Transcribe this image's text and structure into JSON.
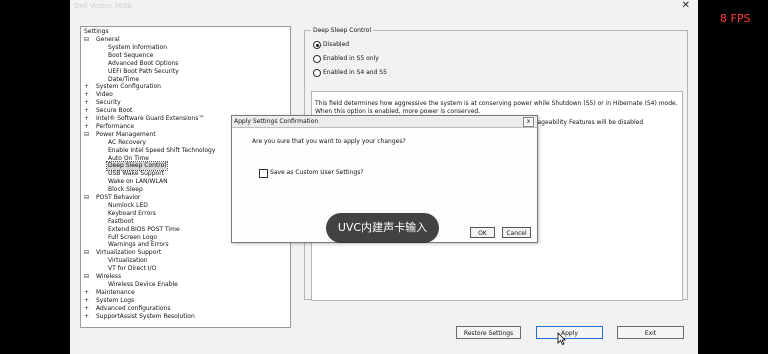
{
  "window": {
    "title": "Dell Vostro 3690",
    "close_glyph": "✕"
  },
  "overlay": {
    "fps": "8 FPS",
    "toast": "UVC内建声卡输入"
  },
  "settings": {
    "title": "Settings",
    "tree": [
      {
        "level": 0,
        "expander": "⊟",
        "label": "General"
      },
      {
        "level": 1,
        "label": "System Information"
      },
      {
        "level": 1,
        "label": "Boot Sequence"
      },
      {
        "level": 1,
        "label": "Advanced Boot Options"
      },
      {
        "level": 1,
        "label": "UEFI Boot Path Security"
      },
      {
        "level": 1,
        "label": "Date/Time"
      },
      {
        "level": 0,
        "expander": "+",
        "label": "System Configuration"
      },
      {
        "level": 0,
        "expander": "+",
        "label": "Video"
      },
      {
        "level": 0,
        "expander": "+",
        "label": "Security"
      },
      {
        "level": 0,
        "expander": "+",
        "label": "Secure Boot"
      },
      {
        "level": 0,
        "expander": "+",
        "label": "Intel® Software Guard Extensions™"
      },
      {
        "level": 0,
        "expander": "+",
        "label": "Performance"
      },
      {
        "level": 0,
        "expander": "⊟",
        "label": "Power Management"
      },
      {
        "level": 1,
        "label": "AC Recovery"
      },
      {
        "level": 1,
        "label": "Enable Intel Speed Shift Technology"
      },
      {
        "level": 1,
        "label": "Auto On Time"
      },
      {
        "level": 1,
        "label": "Deep Sleep Control",
        "selected": true
      },
      {
        "level": 1,
        "label": "USB Wake Support"
      },
      {
        "level": 1,
        "label": "Wake on LAN/WLAN"
      },
      {
        "level": 1,
        "label": "Block Sleep"
      },
      {
        "level": 0,
        "expander": "⊟",
        "label": "POST Behavior"
      },
      {
        "level": 1,
        "label": "Numlock LED"
      },
      {
        "level": 1,
        "label": "Keyboard Errors"
      },
      {
        "level": 1,
        "label": "Fastboot"
      },
      {
        "level": 1,
        "label": "Extend BIOS POST Time"
      },
      {
        "level": 1,
        "label": "Full Screen Logo"
      },
      {
        "level": 1,
        "label": "Warnings and Errors"
      },
      {
        "level": 0,
        "expander": "⊟",
        "label": "Virtualization Support"
      },
      {
        "level": 1,
        "label": "Virtualization"
      },
      {
        "level": 1,
        "label": "VT for Direct I/O"
      },
      {
        "level": 0,
        "expander": "⊟",
        "label": "Wireless"
      },
      {
        "level": 1,
        "label": "Wireless Device Enable"
      },
      {
        "level": 0,
        "expander": "+",
        "label": "Maintenance"
      },
      {
        "level": 0,
        "expander": "+",
        "label": "System Logs"
      },
      {
        "level": 0,
        "expander": "+",
        "label": "Advanced configurations"
      },
      {
        "level": 0,
        "expander": "+",
        "label": "SupportAssist System Resolution"
      }
    ]
  },
  "deep_sleep": {
    "group_title": "Deep Sleep Control",
    "options": [
      {
        "label": "Disabled",
        "selected": true
      },
      {
        "label": "Enabled in S5 only",
        "selected": false
      },
      {
        "label": "Enabled in S4 and S5",
        "selected": false
      }
    ],
    "description": "This field determines how aggressive the system is at conserving power while Shutdown (S5) or in Hibernate (S4) mode.  When this option is enabled, more power is conserved.",
    "description_fragment": "anageability Features will be disabled"
  },
  "footer": {
    "restore": "Restore Settings",
    "apply": "Apply",
    "exit": "Exit"
  },
  "dialog": {
    "title": "Apply Settings Confirmation",
    "close_glyph": "x",
    "question": "Are you sure that you want to apply your changes?",
    "checkbox_label": "Save as Custom User Settings?",
    "ok": "OK",
    "cancel": "Cancel"
  },
  "colors": {
    "fps": "#ff3b3b",
    "background": "#f2f2f2",
    "selection": "#d9d9d9"
  }
}
